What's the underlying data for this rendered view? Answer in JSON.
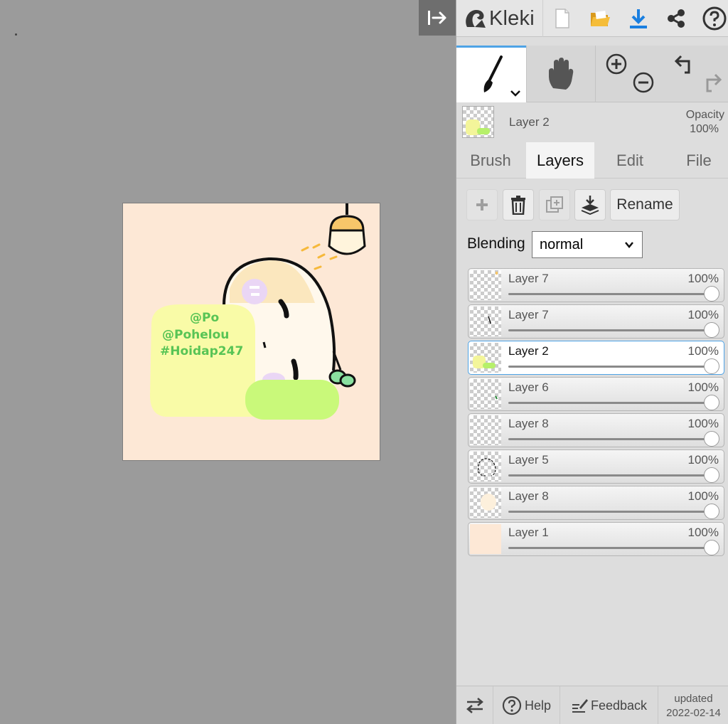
{
  "app": {
    "name": "Kleki"
  },
  "canvas_text": [
    "@Po",
    "@Pohelou",
    "#Hoidap247"
  ],
  "current_layer": {
    "name": "Layer 2",
    "opacity_label": "Opacity",
    "opacity_value": "100%"
  },
  "tabs": [
    "Brush",
    "Layers",
    "Edit",
    "File"
  ],
  "active_tab": "Layers",
  "layer_buttons": {
    "rename": "Rename"
  },
  "blending": {
    "label": "Blending",
    "value": "normal"
  },
  "layers": [
    {
      "name": "Layer 7",
      "opacity": "100%"
    },
    {
      "name": "Layer 7",
      "opacity": "100%"
    },
    {
      "name": "Layer 2",
      "opacity": "100%",
      "selected": true
    },
    {
      "name": "Layer 6",
      "opacity": "100%"
    },
    {
      "name": "Layer 8",
      "opacity": "100%"
    },
    {
      "name": "Layer 5",
      "opacity": "100%"
    },
    {
      "name": "Layer 8",
      "opacity": "100%"
    },
    {
      "name": "Layer 1",
      "opacity": "100%"
    }
  ],
  "footer": {
    "help": "Help",
    "feedback": "Feedback",
    "updated_label": "updated",
    "updated_date": "2022-02-14"
  },
  "colors": {
    "canvas_bg": "#fde8d6",
    "accent": "#4ea3e6",
    "download": "#1a7fe0",
    "folder": "#f0b429"
  },
  "icons": [
    "collapse-panel-icon",
    "kleki-logo-icon",
    "new-image-icon",
    "open-folder-icon",
    "download-icon",
    "share-icon",
    "help-icon",
    "brush-icon",
    "hand-icon",
    "zoom-in-icon",
    "zoom-out-icon",
    "undo-icon",
    "redo-icon",
    "add-layer-icon",
    "delete-layer-icon",
    "duplicate-layer-icon",
    "merge-down-icon",
    "swap-icon",
    "feedback-icon"
  ]
}
